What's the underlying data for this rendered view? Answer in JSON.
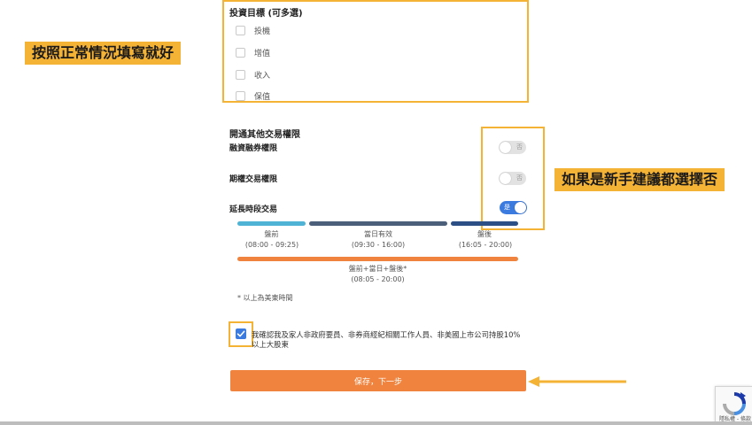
{
  "annotations": {
    "fill_normally": "按照正常情況填寫就好",
    "newbie_choose_no": "如果是新手建議都選擇否"
  },
  "investment_goals": {
    "title": "投資目標 (可多選)",
    "options": [
      "投機",
      "增值",
      "收入",
      "保值"
    ]
  },
  "permissions": {
    "title": "開通其他交易權限",
    "margin": {
      "label": "融資融券權限",
      "state": "否"
    },
    "options": {
      "label": "期權交易權限",
      "state": "否"
    },
    "extended": {
      "label": "延長時段交易",
      "state": "是"
    }
  },
  "sessions": {
    "pre": {
      "name": "盤前",
      "time": "(08:00 - 09:25)"
    },
    "regular": {
      "name": "當日有效",
      "time": "(09:30 - 16:00)"
    },
    "post": {
      "name": "盤後",
      "time": "(16:05 - 20:00)"
    },
    "combined": {
      "name": "盤前+當日+盤後*",
      "time": "(08:05 - 20:00)"
    }
  },
  "note": "* 以上為美東時間",
  "confirmation": {
    "text": "我確認我及家人非政府要員、非券商經紀相關工作人員、非美國上市公司持股10%以上大股東",
    "checked": true
  },
  "save_button": "保存，下一步",
  "recaptcha": {
    "text": "隱私權 - 條款"
  },
  "colors": {
    "annotation": "#f5b335",
    "accent_blue": "#3b7be0",
    "button_orange": "#f0843f",
    "pre_bar": "#4fb3d6",
    "regular_bar": "#4b5f7b",
    "post_bar": "#2c4f86",
    "combined_bar": "#f0843f"
  }
}
